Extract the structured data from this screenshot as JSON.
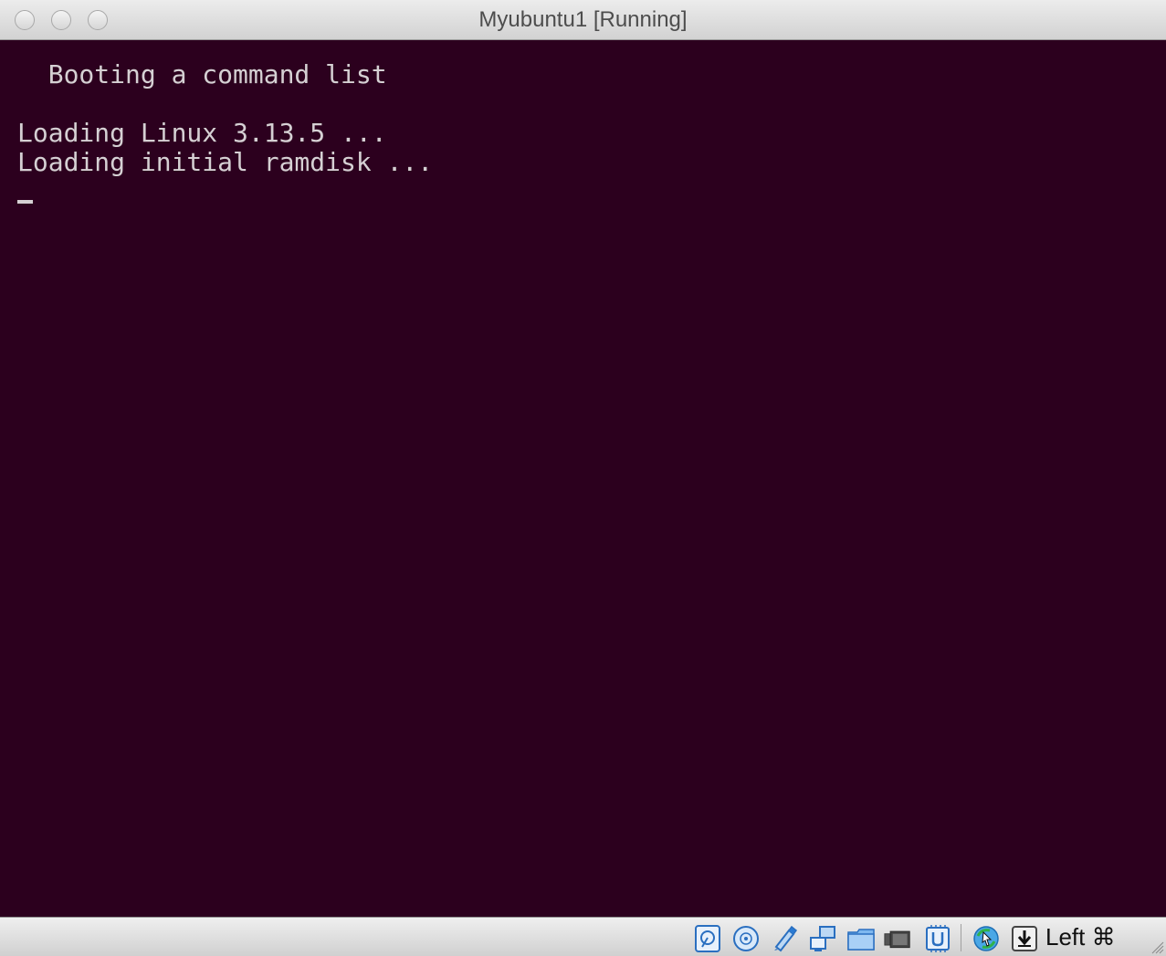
{
  "window": {
    "title": "Myubuntu1 [Running]"
  },
  "console": {
    "lines": [
      "  Booting a command list",
      "Loading Linux 3.13.5 ...",
      "Loading initial ramdisk ..."
    ]
  },
  "statusbar": {
    "icons": [
      "hard-disk-icon",
      "optical-drive-icon",
      "usb-icon",
      "network-icon",
      "shared-folders-icon",
      "video-capture-icon",
      "cpu-virtualization-icon",
      "mouse-integration-icon",
      "keyboard-capture-icon"
    ],
    "host_key": "Left ⌘"
  },
  "colors": {
    "console_bg": "#2c001e",
    "console_fg": "#d5d0d3",
    "icon_blue": "#2a7bd4"
  }
}
